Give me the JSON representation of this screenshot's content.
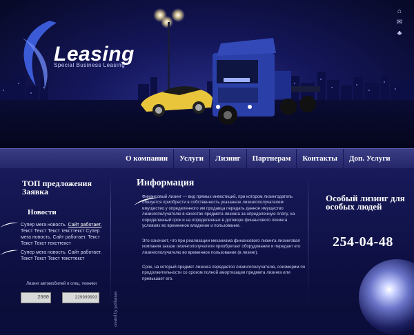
{
  "brand": {
    "name": "Leasing",
    "tagline": "Special Business Leasing"
  },
  "nav": {
    "items": [
      "О компании",
      "Услуги",
      "Лизинг",
      "Партнерам",
      "Контакты",
      "Доп. Услуги"
    ]
  },
  "left": {
    "top_offers": "ТОП предложения Заявка",
    "news_title": "Новости",
    "news": [
      {
        "pre": "Супер мега новость. ",
        "link": "Сайт работает.",
        "body": "Текст Текст Текст текcттекст Супер мега новость. Сайт работает. Текст Текст Текст текcттекст"
      },
      {
        "pre": "Супер мега новость. Сайт работает.",
        "link": "",
        "body": "Текст Текст Текст текcттекст"
      }
    ],
    "ticker_label": "Лизинг автомобилей и спец. техники",
    "counter1": "2600",
    "counter2": "229999993"
  },
  "credit": "created by paShaman",
  "main": {
    "title": "Информация",
    "paragraphs": [
      "Финансовый лизинг — вид прямых инвестиций, при котором лизингодатель обязуется приобрести в собственность указанное лизингополучателем имущество у определенного им продавца передать данное имущество лизингополучателю в качестве предмета лизинга за определенную плату, на определенный срок и на определенных в договоре финансового лизинга условиях во временное владение и пользование.",
      "Это означает, что при реализации механизма финансового лизинга лизинговая компания заказе лизингополучателя приобретает оборудование и передает его лизингополучателю во временное пользование (в лизинг).",
      "Срок, на который предмет лизинга передается лизингополучателю, соизмерим по продолжительности со сроком полной амортизации предмета лизинга или превышает его."
    ]
  },
  "right": {
    "special": "Особый лизинг для особых людей",
    "phone": "254-04-48"
  },
  "icons": [
    "home-icon",
    "mail-icon",
    "sitemap-icon"
  ]
}
